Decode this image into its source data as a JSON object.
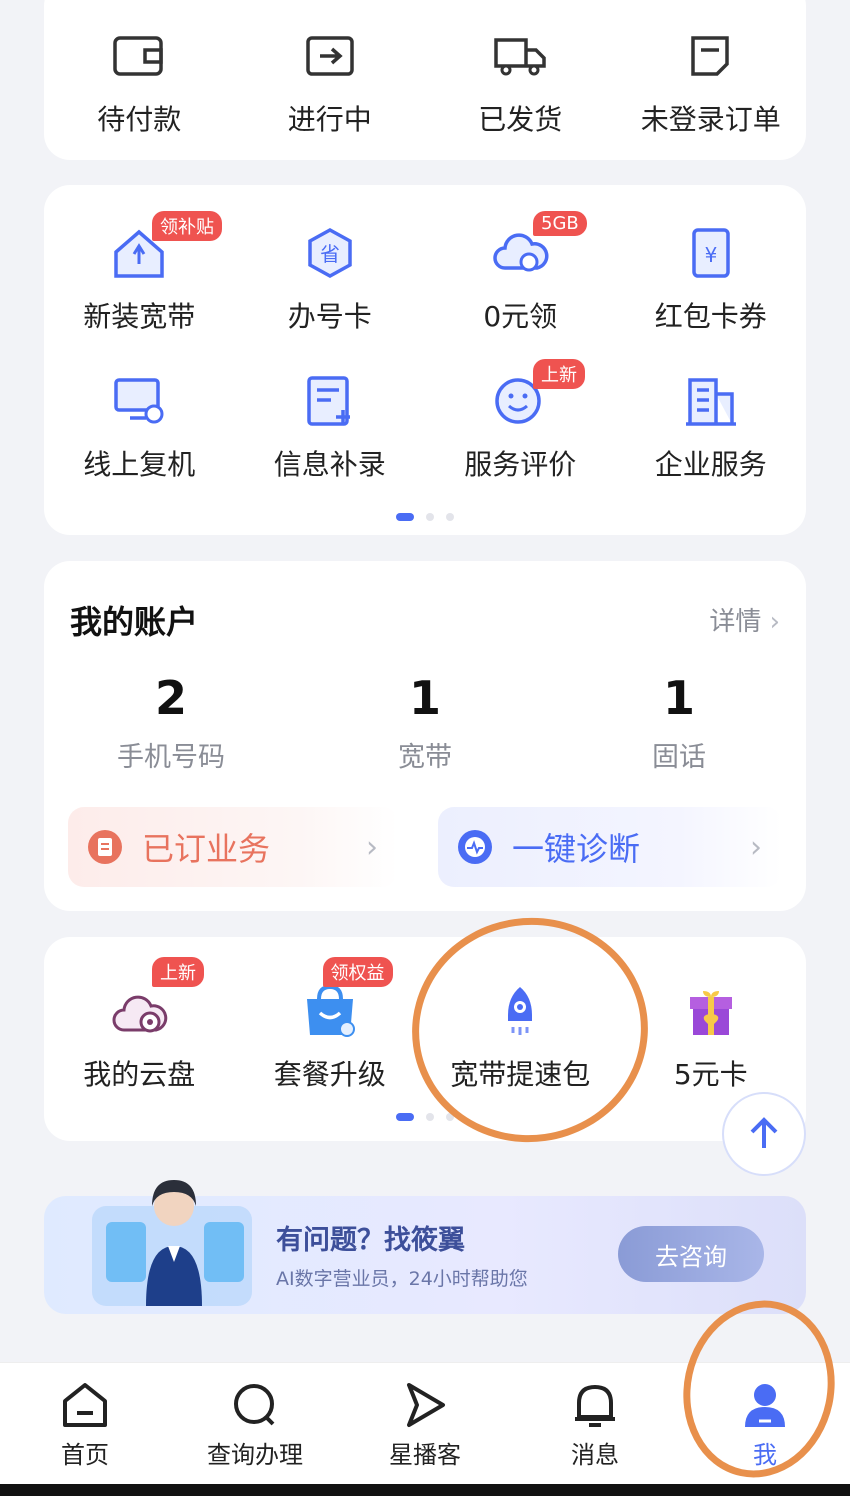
{
  "orders": [
    {
      "label": "待付款",
      "icon": "wallet-icon"
    },
    {
      "label": "进行中",
      "icon": "arrow-box-icon"
    },
    {
      "label": "已发货",
      "icon": "truck-icon"
    },
    {
      "label": "未登录订单",
      "icon": "order-doc-icon"
    }
  ],
  "services": [
    {
      "label": "新装宽带",
      "icon": "home-broadband-icon",
      "badge": "领补贴"
    },
    {
      "label": "办号卡",
      "icon": "sim-card-icon",
      "badge": ""
    },
    {
      "label": "0元领",
      "icon": "cloud-gift-icon",
      "badge": "5GB"
    },
    {
      "label": "红包卡券",
      "icon": "coupon-icon",
      "badge": ""
    },
    {
      "label": "线上复机",
      "icon": "monitor-phone-icon",
      "badge": ""
    },
    {
      "label": "信息补录",
      "icon": "form-add-icon",
      "badge": ""
    },
    {
      "label": "服务评价",
      "icon": "smile-pen-icon",
      "badge": "上新"
    },
    {
      "label": "企业服务",
      "icon": "building-icon",
      "badge": ""
    }
  ],
  "account": {
    "title": "我的账户",
    "detail": "详情",
    "stats": [
      {
        "num": "2",
        "name": "手机号码"
      },
      {
        "num": "1",
        "name": "宽带"
      },
      {
        "num": "1",
        "name": "固话"
      }
    ],
    "ordered": "已订业务",
    "diagnose": "一键诊断"
  },
  "extras": [
    {
      "label": "我的云盘",
      "icon": "cloud-disk-icon",
      "badge": "上新"
    },
    {
      "label": "套餐升级",
      "icon": "shopping-bag-icon",
      "badge": "领权益"
    },
    {
      "label": "宽带提速包",
      "icon": "rocket-icon",
      "badge": ""
    },
    {
      "label": "5元卡",
      "icon": "gift-box-icon",
      "badge": ""
    }
  ],
  "banner": {
    "title": "有问题？找筱翼",
    "subtitle": "AI数字营业员，24小时帮助您",
    "button": "去咨询"
  },
  "nav": [
    {
      "label": "首页",
      "icon": "home-icon"
    },
    {
      "label": "查询办理",
      "icon": "search-icon"
    },
    {
      "label": "星播客",
      "icon": "play-icon"
    },
    {
      "label": "消息",
      "icon": "bell-icon"
    },
    {
      "label": "我",
      "icon": "user-icon",
      "active": true
    }
  ],
  "colors": {
    "accent": "#4a6cf4",
    "badge": "#ef5350",
    "annotation": "#e8904c"
  }
}
